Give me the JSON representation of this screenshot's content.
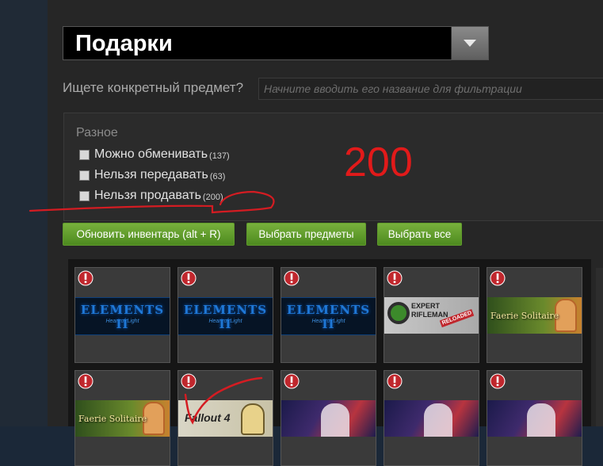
{
  "dropdown": {
    "label": "Подарки"
  },
  "search": {
    "label": "Ищете конкретный предмет?",
    "placeholder": "Начните вводить его название для фильтрации"
  },
  "filters": {
    "title": "Разное",
    "options": [
      {
        "label": "Можно обменивать",
        "count": "(137)"
      },
      {
        "label": "Нельзя передавать",
        "count": "(63)"
      },
      {
        "label": "Нельзя продавать",
        "count": "(200)"
      }
    ]
  },
  "annotation": {
    "text": "200",
    "color": "#e11a1a"
  },
  "buttons": {
    "refresh": "Обновить инвентарь (alt + R)",
    "select_items": "Выбрать предметы",
    "select_all": "Выбрать все"
  },
  "tiles": [
    {
      "art": "elements-ii-banner",
      "title": "ELEMENTS II",
      "subtitle": "Heart of Light"
    },
    {
      "art": "elements-ii-banner",
      "title": "ELEMENTS II",
      "subtitle": "Heart of Light"
    },
    {
      "art": "elements-ii-banner",
      "title": "ELEMENTS II",
      "subtitle": "Heart of Light"
    },
    {
      "art": "expert-rifleman-banner",
      "title": "EXPERT RIFLEMAN",
      "subtitle": "RELOADED"
    },
    {
      "art": "faerie-solitaire-banner",
      "title": "Faerie Solitaire"
    },
    {
      "art": "faerie-solitaire-banner",
      "title": "Faerie Solitaire"
    },
    {
      "art": "fallout-4-banner",
      "title": "Fallout 4"
    },
    {
      "art": "anime-banner"
    },
    {
      "art": "anime-banner"
    },
    {
      "art": "anime-banner"
    }
  ],
  "colors": {
    "accent_green": "#5c9a24",
    "warning_red": "#c0272d",
    "annotation_red": "#e11a1a"
  },
  "icons": {
    "warning": "exclamation-circle-icon",
    "dropdown": "chevron-down-icon"
  }
}
